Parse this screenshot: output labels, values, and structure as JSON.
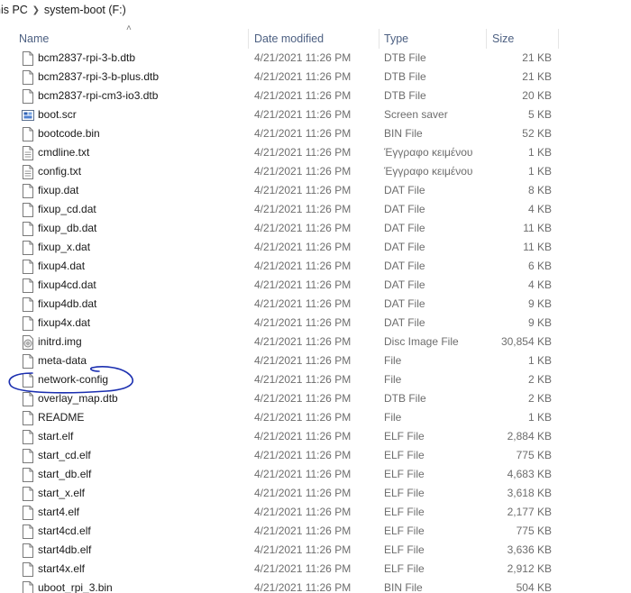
{
  "breadcrumb": {
    "first": "nis PC",
    "second": "system-boot (F:)"
  },
  "columns": {
    "name": "Name",
    "date": "Date modified",
    "type": "Type",
    "size": "Size"
  },
  "accent_colors": {
    "header_text": "#4d6082",
    "annotation": "#1b2fb0"
  },
  "files": [
    {
      "name": "bcm2837-rpi-3-b.dtb",
      "date": "4/21/2021 11:26 PM",
      "type": "DTB File",
      "size": "21 KB",
      "icon": "file-icon"
    },
    {
      "name": "bcm2837-rpi-3-b-plus.dtb",
      "date": "4/21/2021 11:26 PM",
      "type": "DTB File",
      "size": "21 KB",
      "icon": "file-icon"
    },
    {
      "name": "bcm2837-rpi-cm3-io3.dtb",
      "date": "4/21/2021 11:26 PM",
      "type": "DTB File",
      "size": "20 KB",
      "icon": "file-icon"
    },
    {
      "name": "boot.scr",
      "date": "4/21/2021 11:26 PM",
      "type": "Screen saver",
      "size": "5 KB",
      "icon": "screen-saver-icon"
    },
    {
      "name": "bootcode.bin",
      "date": "4/21/2021 11:26 PM",
      "type": "BIN File",
      "size": "52 KB",
      "icon": "file-icon"
    },
    {
      "name": "cmdline.txt",
      "date": "4/21/2021 11:26 PM",
      "type": "Έγγραφο κειμένου",
      "size": "1 KB",
      "icon": "text-file-icon"
    },
    {
      "name": "config.txt",
      "date": "4/21/2021 11:26 PM",
      "type": "Έγγραφο κειμένου",
      "size": "1 KB",
      "icon": "text-file-icon"
    },
    {
      "name": "fixup.dat",
      "date": "4/21/2021 11:26 PM",
      "type": "DAT File",
      "size": "8 KB",
      "icon": "file-icon"
    },
    {
      "name": "fixup_cd.dat",
      "date": "4/21/2021 11:26 PM",
      "type": "DAT File",
      "size": "4 KB",
      "icon": "file-icon"
    },
    {
      "name": "fixup_db.dat",
      "date": "4/21/2021 11:26 PM",
      "type": "DAT File",
      "size": "11 KB",
      "icon": "file-icon"
    },
    {
      "name": "fixup_x.dat",
      "date": "4/21/2021 11:26 PM",
      "type": "DAT File",
      "size": "11 KB",
      "icon": "file-icon"
    },
    {
      "name": "fixup4.dat",
      "date": "4/21/2021 11:26 PM",
      "type": "DAT File",
      "size": "6 KB",
      "icon": "file-icon"
    },
    {
      "name": "fixup4cd.dat",
      "date": "4/21/2021 11:26 PM",
      "type": "DAT File",
      "size": "4 KB",
      "icon": "file-icon"
    },
    {
      "name": "fixup4db.dat",
      "date": "4/21/2021 11:26 PM",
      "type": "DAT File",
      "size": "9 KB",
      "icon": "file-icon"
    },
    {
      "name": "fixup4x.dat",
      "date": "4/21/2021 11:26 PM",
      "type": "DAT File",
      "size": "9 KB",
      "icon": "file-icon"
    },
    {
      "name": "initrd.img",
      "date": "4/21/2021 11:26 PM",
      "type": "Disc Image File",
      "size": "30,854 KB",
      "icon": "disc-image-icon"
    },
    {
      "name": "meta-data",
      "date": "4/21/2021 11:26 PM",
      "type": "File",
      "size": "1 KB",
      "icon": "file-icon"
    },
    {
      "name": "network-config",
      "date": "4/21/2021 11:26 PM",
      "type": "File",
      "size": "2 KB",
      "icon": "file-icon"
    },
    {
      "name": "overlay_map.dtb",
      "date": "4/21/2021 11:26 PM",
      "type": "DTB File",
      "size": "2 KB",
      "icon": "file-icon"
    },
    {
      "name": "README",
      "date": "4/21/2021 11:26 PM",
      "type": "File",
      "size": "1 KB",
      "icon": "file-icon"
    },
    {
      "name": "start.elf",
      "date": "4/21/2021 11:26 PM",
      "type": "ELF File",
      "size": "2,884 KB",
      "icon": "file-icon"
    },
    {
      "name": "start_cd.elf",
      "date": "4/21/2021 11:26 PM",
      "type": "ELF File",
      "size": "775 KB",
      "icon": "file-icon"
    },
    {
      "name": "start_db.elf",
      "date": "4/21/2021 11:26 PM",
      "type": "ELF File",
      "size": "4,683 KB",
      "icon": "file-icon"
    },
    {
      "name": "start_x.elf",
      "date": "4/21/2021 11:26 PM",
      "type": "ELF File",
      "size": "3,618 KB",
      "icon": "file-icon"
    },
    {
      "name": "start4.elf",
      "date": "4/21/2021 11:26 PM",
      "type": "ELF File",
      "size": "2,177 KB",
      "icon": "file-icon"
    },
    {
      "name": "start4cd.elf",
      "date": "4/21/2021 11:26 PM",
      "type": "ELF File",
      "size": "775 KB",
      "icon": "file-icon"
    },
    {
      "name": "start4db.elf",
      "date": "4/21/2021 11:26 PM",
      "type": "ELF File",
      "size": "3,636 KB",
      "icon": "file-icon"
    },
    {
      "name": "start4x.elf",
      "date": "4/21/2021 11:26 PM",
      "type": "ELF File",
      "size": "2,912 KB",
      "icon": "file-icon"
    },
    {
      "name": "uboot_rpi_3.bin",
      "date": "4/21/2021 11:26 PM",
      "type": "BIN File",
      "size": "504 KB",
      "icon": "file-icon"
    }
  ]
}
